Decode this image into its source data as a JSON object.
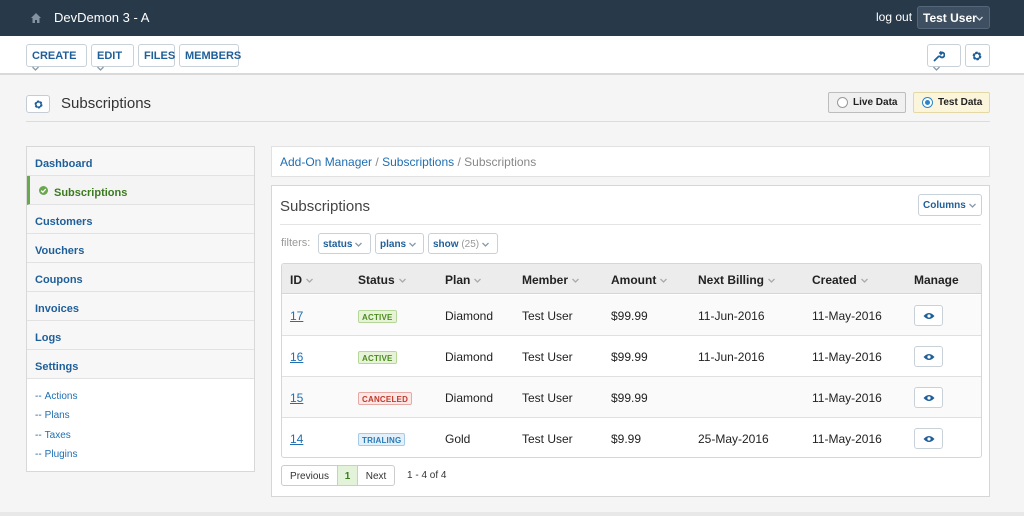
{
  "topbar": {
    "site_name": "DevDemon 3 - A",
    "logout": "log out",
    "user": "Test User"
  },
  "toolbar": {
    "create": "CREATE",
    "edit": "EDIT",
    "files": "FILES",
    "members": "MEMBERS"
  },
  "header": {
    "title": "Subscriptions",
    "live_data": "Live Data",
    "test_data": "Test Data",
    "selected_mode": "Test Data"
  },
  "sidebar": {
    "items": [
      "Dashboard",
      "Subscriptions",
      "Customers",
      "Vouchers",
      "Coupons",
      "Invoices",
      "Logs",
      "Settings"
    ],
    "active": "Subscriptions",
    "settings_sub": [
      "Actions",
      "Plans",
      "Taxes",
      "Plugins"
    ]
  },
  "breadcrumb": {
    "root": "Add-On Manager",
    "sep1": "/",
    "parent": "Subscriptions",
    "sep2": "/",
    "current": "Subscriptions"
  },
  "panel": {
    "title": "Subscriptions",
    "columns_button": "Columns"
  },
  "filters": {
    "label": "filters:",
    "status": "status",
    "plans": "plans",
    "show": "show",
    "show_count": "(25)"
  },
  "table": {
    "headers": [
      "ID",
      "Status",
      "Plan",
      "Member",
      "Amount",
      "Next Billing",
      "Created",
      "Manage"
    ],
    "rows": [
      {
        "id": "17",
        "status": "ACTIVE",
        "plan": "Diamond",
        "member": "Test User",
        "amount": "$99.99",
        "next_billing": "11-Jun-2016",
        "created": "11-May-2016"
      },
      {
        "id": "16",
        "status": "ACTIVE",
        "plan": "Diamond",
        "member": "Test User",
        "amount": "$99.99",
        "next_billing": "11-Jun-2016",
        "created": "11-May-2016"
      },
      {
        "id": "15",
        "status": "CANCELED",
        "plan": "Diamond",
        "member": "Test User",
        "amount": "$99.99",
        "next_billing": "",
        "created": "11-May-2016"
      },
      {
        "id": "14",
        "status": "TRIALING",
        "plan": "Gold",
        "member": "Test User",
        "amount": "$9.99",
        "next_billing": "25-May-2016",
        "created": "11-May-2016"
      }
    ]
  },
  "pagination": {
    "previous": "Previous",
    "current": "1",
    "next": "Next",
    "info": "1 - 4 of 4"
  },
  "colors": {
    "topbar": "#28394a",
    "link": "#1f6fb2",
    "active_green": "#6aa84f",
    "radio_blue": "#2c85c8"
  },
  "icons": [
    "home-icon",
    "chevron-down-icon",
    "wrench-icon",
    "gear-icon",
    "check-circle-icon",
    "eye-icon"
  ]
}
